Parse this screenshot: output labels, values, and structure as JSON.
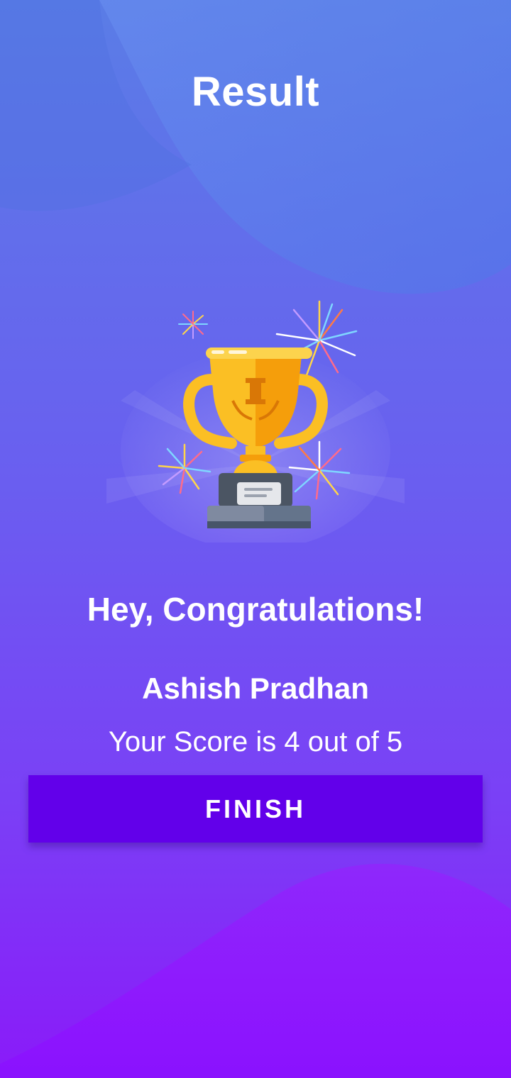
{
  "header": {
    "title": "Result"
  },
  "result": {
    "congratulations": "Hey, Congratulations!",
    "user_name": "Ashish Pradhan",
    "score_text": "Your Score is 4 out of 5",
    "score": 4,
    "total": 5
  },
  "actions": {
    "finish_label": "FINISH"
  },
  "theme": {
    "background_top": "#5a7de6",
    "background_bottom": "#8a1af9",
    "button_color": "#6200ea",
    "text_color": "#ffffff"
  },
  "illustration": {
    "icon": "trophy-icon"
  }
}
